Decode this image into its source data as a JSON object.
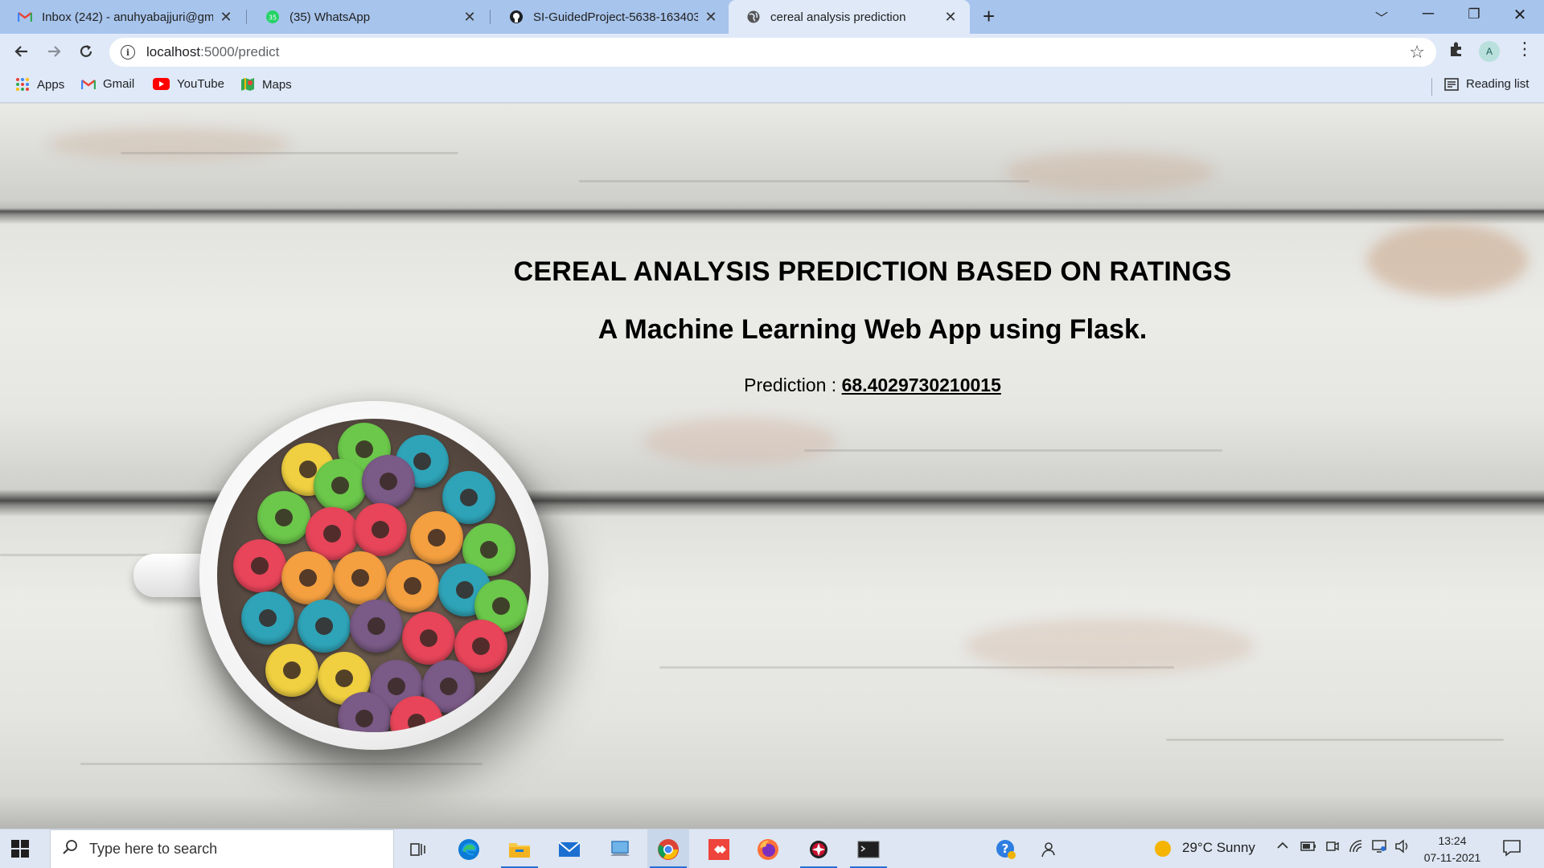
{
  "browser": {
    "tabs": [
      {
        "title": "Inbox (242) - anuhyabajjuri@gmail.com",
        "icon": "gmail-icon",
        "active": false
      },
      {
        "title": "(35) WhatsApp",
        "icon": "whatsapp-icon",
        "badge": "35",
        "active": false
      },
      {
        "title": "SI-GuidedProject-5638-1634039",
        "icon": "github-icon",
        "active": false
      },
      {
        "title": "cereal analysis prediction",
        "icon": "globe-icon",
        "active": true
      }
    ],
    "new_tab": "+",
    "address": {
      "host": "localhost",
      "path": ":5000/predict"
    },
    "profile_initial": "A",
    "bookmarks": [
      {
        "label": "Apps",
        "icon": "apps-grid-icon"
      },
      {
        "label": "Gmail",
        "icon": "gmail-icon"
      },
      {
        "label": "YouTube",
        "icon": "youtube-icon"
      },
      {
        "label": "Maps",
        "icon": "maps-icon"
      }
    ],
    "reading_list": "Reading list"
  },
  "page": {
    "heading": "CEREAL ANALYSIS PREDICTION BASED ON RATINGS",
    "subheading": "A Machine Learning Web App using Flask.",
    "prediction_label": "Prediction : ",
    "prediction_value": "68.4029730210015"
  },
  "taskbar": {
    "search_placeholder": "Type here to search",
    "weather": "29°C  Sunny",
    "time": "13:24",
    "date": "07-11-2021"
  },
  "colors": {
    "tabstrip": "#a7c4ec",
    "toolbar": "#dfe9f8",
    "taskbar": "#dde6f2",
    "taskbar_running": "#2a6fd4"
  }
}
